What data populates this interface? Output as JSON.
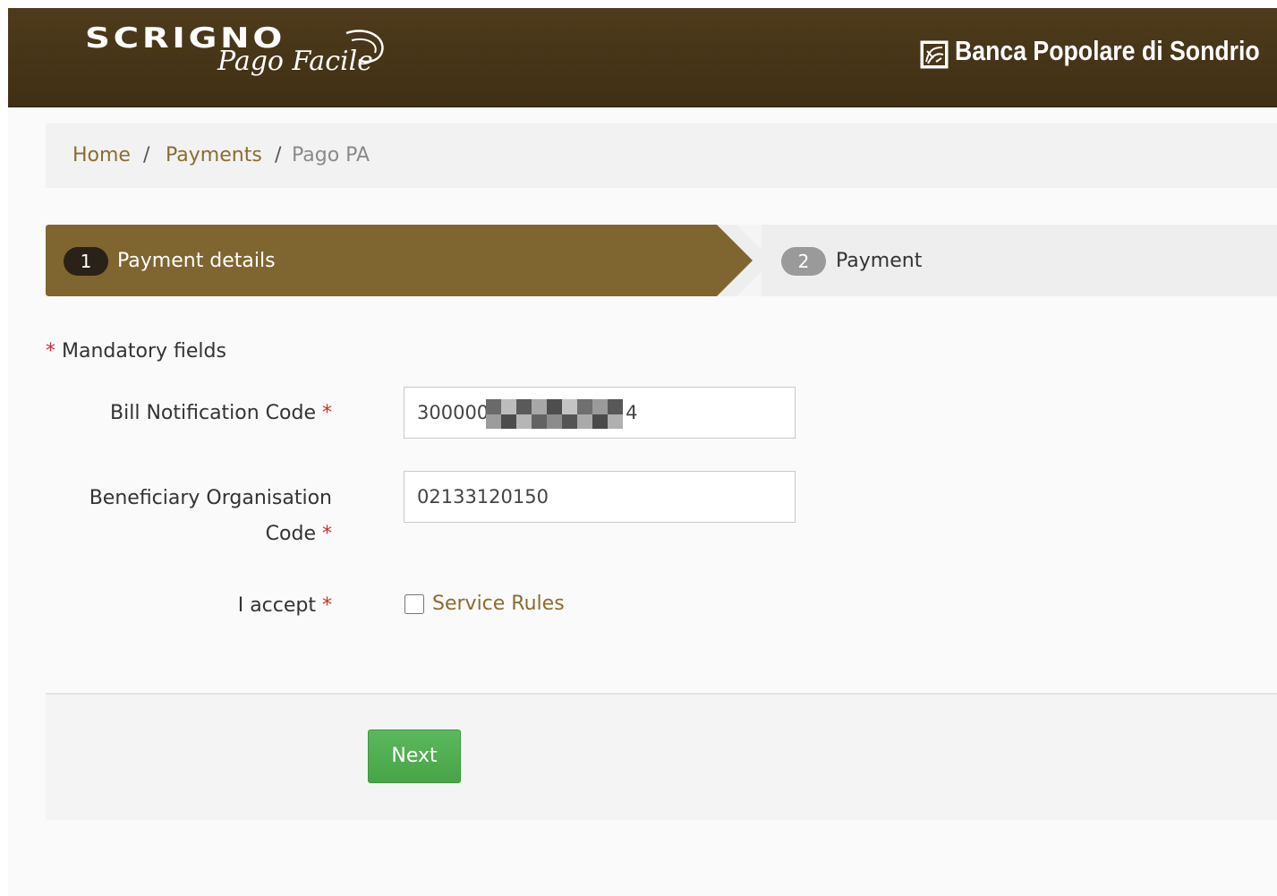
{
  "header": {
    "logo_main": "SCRIGNO",
    "logo_sub": "Pago Facile",
    "bank_name": "Banca Popolare di Sondrio",
    "bank_icon": "bank-logo-icon"
  },
  "breadcrumb": {
    "items": [
      {
        "label": "Home"
      },
      {
        "label": "Payments"
      },
      {
        "label": "Pago PA"
      }
    ],
    "separator": "/"
  },
  "steps": [
    {
      "number": "1",
      "label": "Payment details",
      "active": true
    },
    {
      "number": "2",
      "label": "Payment",
      "active": false
    }
  ],
  "form": {
    "mandatory_star": "*",
    "mandatory_text": "Mandatory fields",
    "bill_code": {
      "label": "Bill Notification Code",
      "star": "*",
      "value": "300000",
      "value_suffix": "4",
      "redacted": true
    },
    "beneficiary_code": {
      "label_line1": "Beneficiary Organisation",
      "label_line2": "Code",
      "star": "*",
      "value": "02133120150"
    },
    "accept": {
      "label": "I accept",
      "star": "*",
      "checked": false,
      "link_label": "Service Rules"
    }
  },
  "actions": {
    "next_label": "Next"
  },
  "colors": {
    "header_bg": "#4a371a",
    "accent_gold": "#8a6d2e",
    "step_active_bg": "#7f6530",
    "required_star": "#c9302c",
    "next_green": "#5cb85c"
  }
}
